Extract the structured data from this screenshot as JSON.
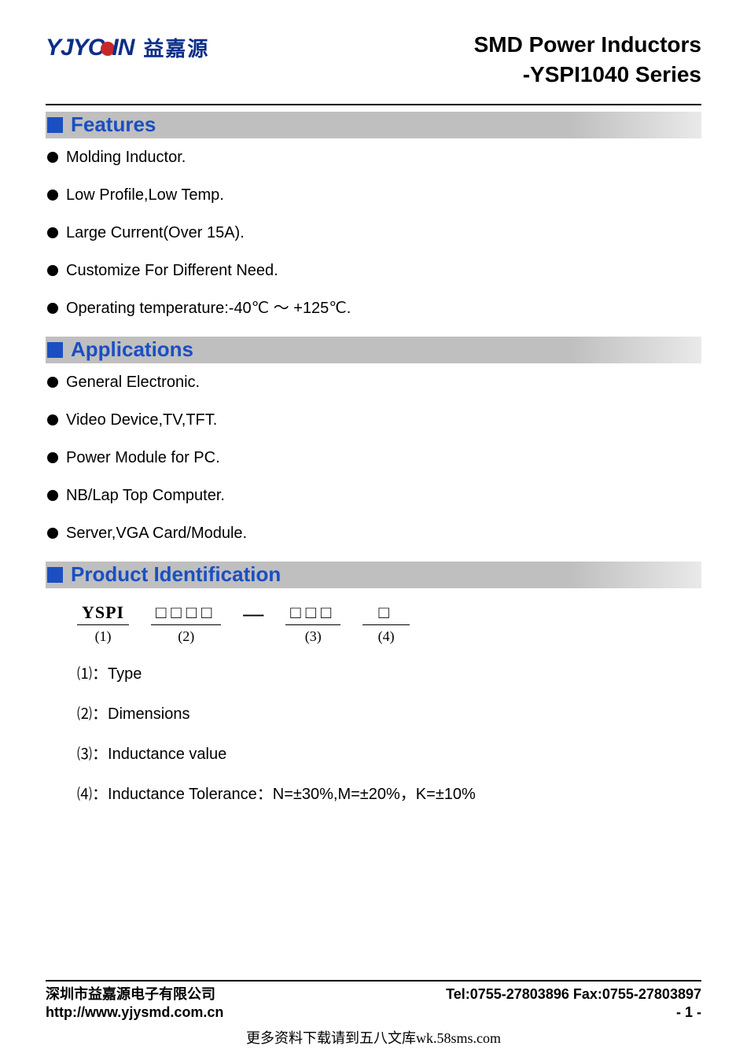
{
  "logo": {
    "mark_left": "YJYC",
    "mark_right": "IN",
    "cn": "益嘉源"
  },
  "title": {
    "line1": "SMD Power Inductors",
    "line2": "-YSPI1040 Series"
  },
  "sections": {
    "features": {
      "heading": "Features",
      "items": [
        "Molding Inductor.",
        "Low Profile,Low Temp.",
        "Large Current(Over 15A).",
        "Customize For Different Need.",
        "Operating temperature:-40℃ ～ +125℃."
      ]
    },
    "applications": {
      "heading": "Applications",
      "items": [
        "General Electronic.",
        "Video Device,TV,TFT.",
        "Power Module for PC.",
        "NB/Lap Top Computer.",
        "Server,VGA Card/Module."
      ]
    },
    "product_id": {
      "heading": "Product Identification",
      "scheme": {
        "p1": "YSPI",
        "s1": "(1)",
        "p2": "□□□□",
        "s2": "(2)",
        "dash": "—",
        "p3": "□□□",
        "s3": "(3)",
        "p4": "□",
        "s4": "(4)"
      },
      "legend": [
        {
          "n": "⑴",
          "t": "：Type"
        },
        {
          "n": "⑵",
          "t": "：Dimensions"
        },
        {
          "n": "⑶",
          "t": "：Inductance value"
        },
        {
          "n": "⑷",
          "t": "：Inductance Tolerance：N=±30%,M=±20%，K=±10%"
        }
      ]
    }
  },
  "footer": {
    "company": "深圳市益嘉源电子有限公司",
    "contact": "Tel:0755-27803896   Fax:0755-27803897",
    "url": "http://www.yjysmd.com.cn",
    "page": "- 1 -"
  },
  "watermark": "更多资料下载请到五八文库wk.58sms.com"
}
